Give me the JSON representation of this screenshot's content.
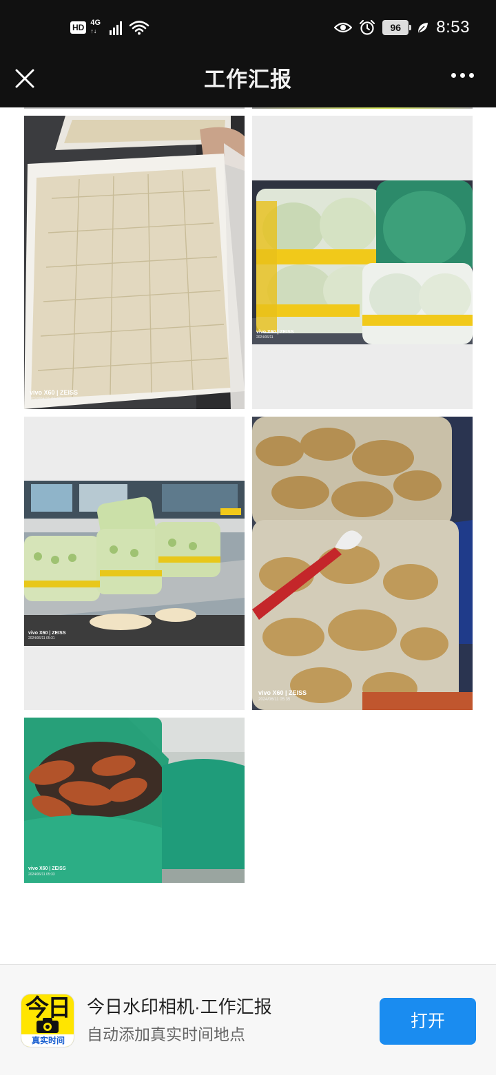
{
  "status_bar": {
    "hd": "HD",
    "network": "4G",
    "network_sub": "↑↓",
    "battery": "96",
    "time": "8:53"
  },
  "nav": {
    "title": "工作汇报"
  },
  "photos": [
    {
      "watermark": "vivo X60 | ZEISS",
      "datetime": "2024/06/11 05:09"
    },
    {
      "watermark": "vivo X60 | ZEISS",
      "datetime": "2024/06/11"
    },
    {
      "watermark": "vivo X60 | ZEISS",
      "datetime": "2024/06/11 05:31"
    },
    {
      "watermark": "vivo X60 | ZEISS",
      "datetime": "2024/06/11 05:35"
    },
    {
      "watermark": "vivo X60 | ZEISS",
      "datetime": "2024/06/11 05:33"
    }
  ],
  "footer": {
    "app_icon_line1": "今日",
    "app_icon_line2": "真实时间",
    "app_title": "今日水印相机·工作汇报",
    "app_subtitle": "自动添加真实时间地点",
    "open_label": "打开"
  },
  "colors": {
    "bar_bg": "#111111",
    "open_button": "#1a8cf0",
    "app_icon_bg": "#ffe500"
  }
}
